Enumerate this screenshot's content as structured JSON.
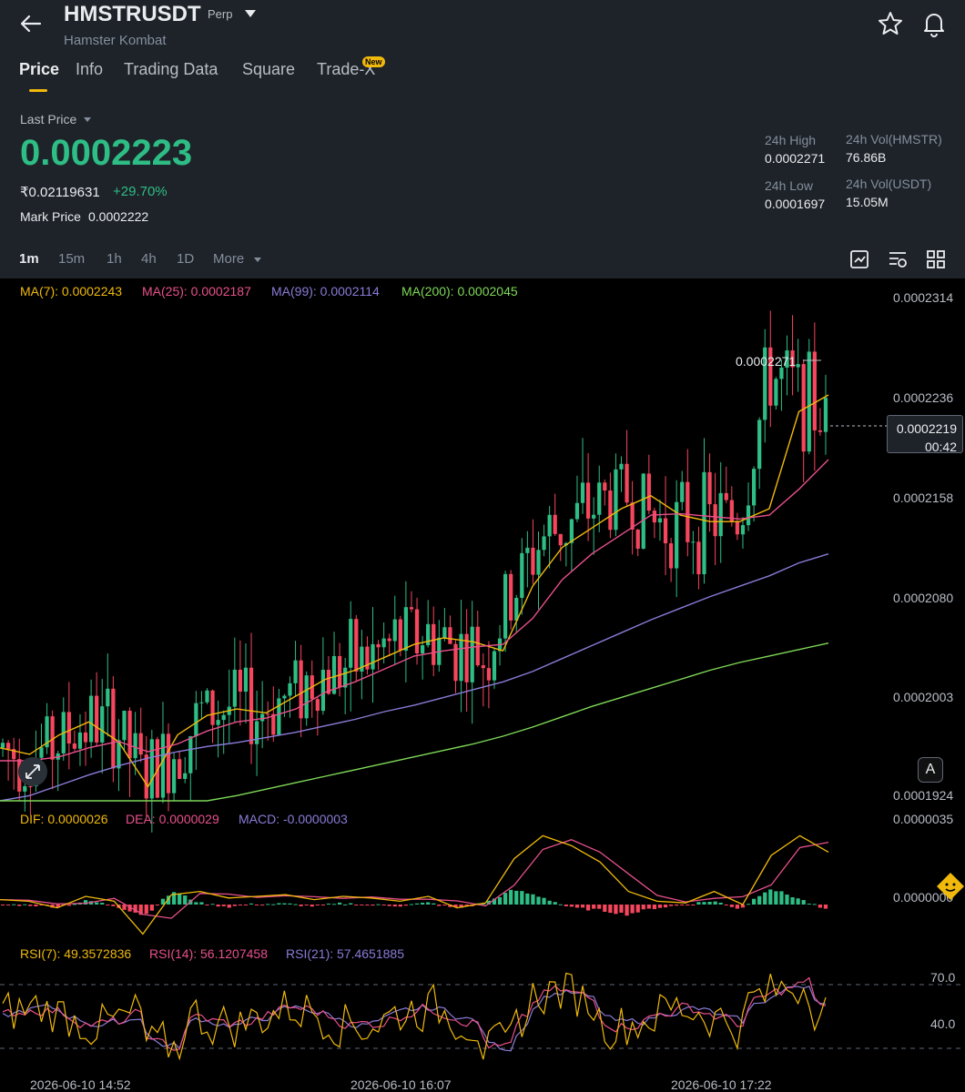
{
  "header": {
    "symbol": "HMSTRUSDT",
    "contract_type": "Perp",
    "name": "Hamster Kombat",
    "icons": [
      "back-arrow-icon",
      "chevron-down-icon",
      "star-icon",
      "bell-icon"
    ]
  },
  "tabs": [
    {
      "label": "Price",
      "active": true
    },
    {
      "label": "Info"
    },
    {
      "label": "Trading Data"
    },
    {
      "label": "Square"
    },
    {
      "label": "Trade-X",
      "badge": "New"
    }
  ],
  "ticker": {
    "last_price_label": "Last Price",
    "last_price": "0.0002223",
    "fiat_price": "₹0.02119631",
    "change_pct": "+29.70%",
    "mark_price_label": "Mark Price",
    "mark_price": "0.0002222",
    "high_24h_label": "24h High",
    "high_24h": "0.0002271",
    "low_24h_label": "24h Low",
    "low_24h": "0.0001697",
    "vol_base_label": "24h Vol(HMSTR)",
    "vol_base": "76.86B",
    "vol_quote_label": "24h Vol(USDT)",
    "vol_quote": "15.05M"
  },
  "timeframes": [
    {
      "label": "1m",
      "active": true
    },
    {
      "label": "15m"
    },
    {
      "label": "1h"
    },
    {
      "label": "4h"
    },
    {
      "label": "1D"
    },
    {
      "label": "More"
    }
  ],
  "toolbar_icons": [
    "chart-settings-icon",
    "indicator-icon",
    "layout-grid-icon"
  ],
  "colors": {
    "up": "#2ebd85",
    "down": "#f6465d",
    "accent": "#f0b90b",
    "ma7": "#f0b90b",
    "ma25": "#e8508c",
    "ma99": "#8a7bd8",
    "ma200": "#7ed957",
    "dif": "#f0b90b",
    "dea": "#e8508c",
    "macd": "#8a7bd8",
    "rsi7": "#f0b90b",
    "rsi14": "#e8508c",
    "rsi21": "#8a7bd8"
  },
  "legends": {
    "ma": [
      {
        "text": "MA(7): 0.0002243"
      },
      {
        "text": "MA(25): 0.0002187"
      },
      {
        "text": "MA(99): 0.0002114"
      },
      {
        "text": "MA(200): 0.0002045"
      }
    ],
    "macd": [
      {
        "text": "DIF: 0.0000026"
      },
      {
        "text": "DEA: 0.0000029"
      },
      {
        "text": "MACD: -0.0000003"
      }
    ],
    "rsi": [
      {
        "text": "RSI(7): 49.3572836"
      },
      {
        "text": "RSI(14): 56.1207458"
      },
      {
        "text": "RSI(21): 57.4651885"
      }
    ]
  },
  "chart_data": {
    "type": "candlestick",
    "y_ticks": [
      "0.0002314",
      "0.0002236",
      "0.0002158",
      "0.0002080",
      "0.0002003",
      "0.0001924"
    ],
    "ylim": [
      0.0001924,
      0.0002314
    ],
    "high_marker": "0.0002271",
    "current_price": "0.0002219",
    "countdown": "00:42",
    "x_ticks": [
      "2026-06-10 14:52",
      "2026-06-10 16:07",
      "2026-06-10 17:22"
    ],
    "macd_y_ticks": [
      "0.0000035",
      "0.0000000"
    ],
    "rsi_levels": [
      "70.0",
      "40.0"
    ],
    "ma_series": [
      {
        "name": "MA(7)",
        "values": [
          0.0001965,
          0.000196,
          0.0001975,
          0.0001985,
          0.000197,
          0.0001935,
          0.0001975,
          0.000199,
          0.0001995,
          0.0001992,
          0.0002005,
          0.0002018,
          0.0002025,
          0.0002035,
          0.0002045,
          0.000205,
          0.0002047,
          0.000204,
          0.000209,
          0.000212,
          0.0002135,
          0.000215,
          0.000216,
          0.0002145,
          0.000214,
          0.000214,
          0.000215,
          0.0002225,
          0.0002238
        ]
      },
      {
        "name": "MA(25)",
        "values": [
          0.0001955,
          0.0001955,
          0.0001958,
          0.0001965,
          0.000197,
          0.0001962,
          0.0001968,
          0.0001978,
          0.0001985,
          0.0001988,
          0.0001995,
          0.0002008,
          0.0002016,
          0.0002026,
          0.0002036,
          0.000204,
          0.0002043,
          0.0002045,
          0.0002065,
          0.0002095,
          0.0002115,
          0.000213,
          0.0002145,
          0.0002146,
          0.0002144,
          0.0002142,
          0.0002145,
          0.0002165,
          0.0002188
        ]
      },
      {
        "name": "MA(99)",
        "values": [
          0.000192,
          0.0001928,
          0.0001936,
          0.0001944,
          0.0001951,
          0.0001957,
          0.0001962,
          0.0001966,
          0.0001969,
          0.0001973,
          0.0001977,
          0.0001982,
          0.0001987,
          0.0001993,
          0.0001998,
          0.0002004,
          0.000201,
          0.0002016,
          0.0002024,
          0.0002034,
          0.0002044,
          0.0002054,
          0.0002064,
          0.0002073,
          0.0002082,
          0.000209,
          0.0002098,
          0.0002108,
          0.0002115
        ]
      },
      {
        "name": "MA(200)",
        "values": [
          0.000186,
          0.000187,
          0.000188,
          0.000189,
          0.00019,
          0.0001908,
          0.0001915,
          0.0001922,
          0.0001928,
          0.0001933,
          0.0001938,
          0.0001943,
          0.0001948,
          0.0001953,
          0.0001958,
          0.0001963,
          0.0001968,
          0.0001974,
          0.0001981,
          0.0001989,
          0.0001997,
          0.0002004,
          0.0002011,
          0.0002018,
          0.0002025,
          0.0002031,
          0.0002036,
          0.0002041,
          0.0002046
        ]
      }
    ],
    "candle_trend": [
      0.0001965,
      0.0001958,
      0.000197,
      0.0001985,
      0.000198,
      0.000194,
      0.0001962,
      0.000199,
      0.0001997,
      0.0001993,
      0.0002005,
      0.000202,
      0.0002027,
      0.0002035,
      0.0002048,
      0.0002052,
      0.0002044,
      0.0002035,
      0.0002085,
      0.0002128,
      0.0002138,
      0.0002155,
      0.0002162,
      0.000214,
      0.0002138,
      0.0002142,
      0.0002145,
      0.0002255,
      0.000224,
      0.0002219
    ]
  }
}
